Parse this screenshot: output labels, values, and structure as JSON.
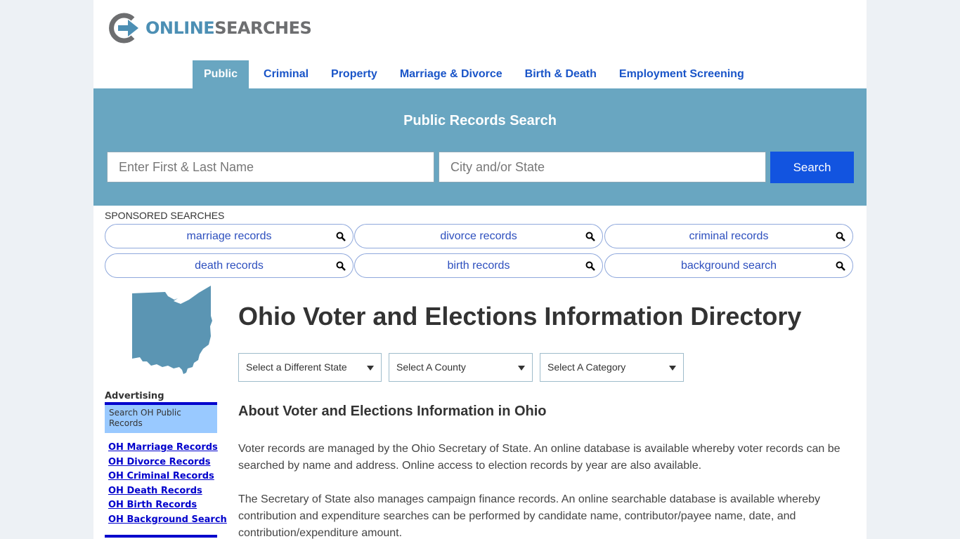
{
  "brand": {
    "name_part1": "ONLINE",
    "name_part2": "SEARCHES",
    "colors": {
      "primary_blue": "#4c8fb4",
      "gray": "#6d6e70"
    }
  },
  "nav": {
    "items": [
      {
        "label": "Public",
        "active": true
      },
      {
        "label": "Criminal"
      },
      {
        "label": "Property"
      },
      {
        "label": "Marriage & Divorce"
      },
      {
        "label": "Birth & Death"
      },
      {
        "label": "Employment Screening"
      }
    ]
  },
  "search": {
    "title": "Public Records Search",
    "name_placeholder": "Enter First & Last Name",
    "location_placeholder": "City and/or State",
    "button_label": "Search"
  },
  "sponsored": {
    "label": "SPONSORED SEARCHES",
    "items": [
      {
        "label": "marriage records",
        "icon": "search-icon"
      },
      {
        "label": "divorce records",
        "icon": "search-icon"
      },
      {
        "label": "criminal records",
        "icon": "search-icon"
      },
      {
        "label": "death records",
        "icon": "search-icon"
      },
      {
        "label": "birth records",
        "icon": "search-icon"
      },
      {
        "label": "background search",
        "icon": "search-icon"
      }
    ]
  },
  "sidebar": {
    "state_map_alt": "Ohio",
    "advertising_label": "Advertising",
    "ad_box_title": "Search OH Public Records",
    "links": [
      "OH Marriage Records",
      "OH Divorce Records",
      "OH Criminal Records",
      "OH Death Records",
      "OH Birth Records",
      "OH Background Search"
    ]
  },
  "main": {
    "title": "Ohio Voter and Elections Information Directory",
    "selects": {
      "state": "Select a Different State",
      "county": "Select A County",
      "category": "Select A Category"
    },
    "section_title": "About Voter and Elections Information in Ohio",
    "paragraphs": [
      "Voter records are managed by the Ohio Secretary of State. An online database is available whereby voter records can be searched by name and address. Online access to election records by year are also available.",
      "The Secretary of State also manages campaign finance records. An online searchable database is available whereby contribution and expenditure searches can be performed by candidate name, contributor/payee name, date, and contribution/expenditure amount."
    ]
  }
}
